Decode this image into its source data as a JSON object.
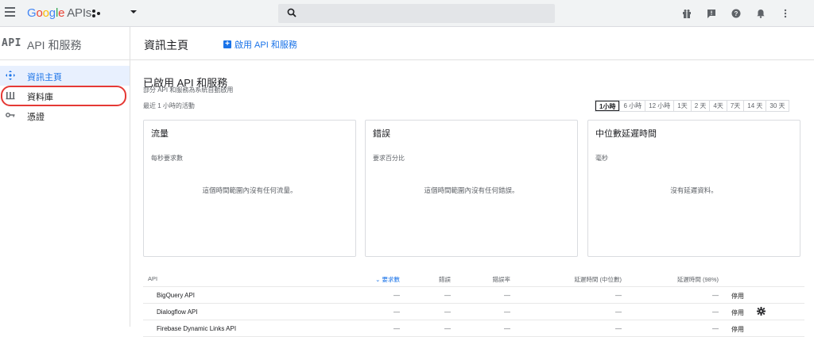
{
  "topbar": {
    "logo_letters": [
      "G",
      "o",
      "o",
      "g",
      "l",
      "e"
    ],
    "logo_suffix": "APIs",
    "search_placeholder": ""
  },
  "leftnav": {
    "api_mark": "API",
    "title": "API 和服務",
    "items": [
      {
        "label": "資訊主頁",
        "icon": "dashboard-icon",
        "active": true
      },
      {
        "label": "資料庫",
        "icon": "library-icon",
        "active": false
      },
      {
        "label": "憑證",
        "icon": "key-icon",
        "active": false
      }
    ]
  },
  "main": {
    "page_title": "資訊主頁",
    "enable_button": "啟用 API 和服務",
    "section_title": "已啟用 API 和服務",
    "section_subtitle": "部分 API 和服務為系統自動啟用",
    "recent_label": "最近 1 小時的活動",
    "time_ranges": [
      "1小時",
      "6 小時",
      "12 小時",
      "1天",
      "2 天",
      "4天",
      "7天",
      "14 天",
      "30 天"
    ],
    "selected_range": "1小時",
    "cards": [
      {
        "title": "流量",
        "subtitle": "每秒要求數",
        "empty": "這個時間範圍內沒有任何流量。"
      },
      {
        "title": "錯誤",
        "subtitle": "要求百分比",
        "empty": "這個時間範圍內沒有任何錯誤。"
      },
      {
        "title": "中位數延遲時間",
        "subtitle": "毫秒",
        "empty": "沒有延遲資料。"
      }
    ],
    "table": {
      "headers": [
        "API",
        "要求數",
        "錯誤",
        "錯誤率",
        "延遲時間 (中位數)",
        "延遲時間 (98%)"
      ],
      "rows": [
        {
          "name": "BigQuery API",
          "requests": "—",
          "errors": "—",
          "error_rate": "—",
          "latency_median": "—",
          "latency_98": "—",
          "action": "停用",
          "has_settings": false
        },
        {
          "name": "Dialogflow API",
          "requests": "—",
          "errors": "—",
          "error_rate": "—",
          "latency_median": "—",
          "latency_98": "—",
          "action": "停用",
          "has_settings": true
        },
        {
          "name": "Firebase Dynamic Links API",
          "requests": "—",
          "errors": "—",
          "error_rate": "—",
          "latency_median": "—",
          "latency_98": "—",
          "action": "停用",
          "has_settings": false
        }
      ]
    }
  },
  "colors": {
    "accent": "#1a73e8",
    "annotation": "#e53935"
  }
}
